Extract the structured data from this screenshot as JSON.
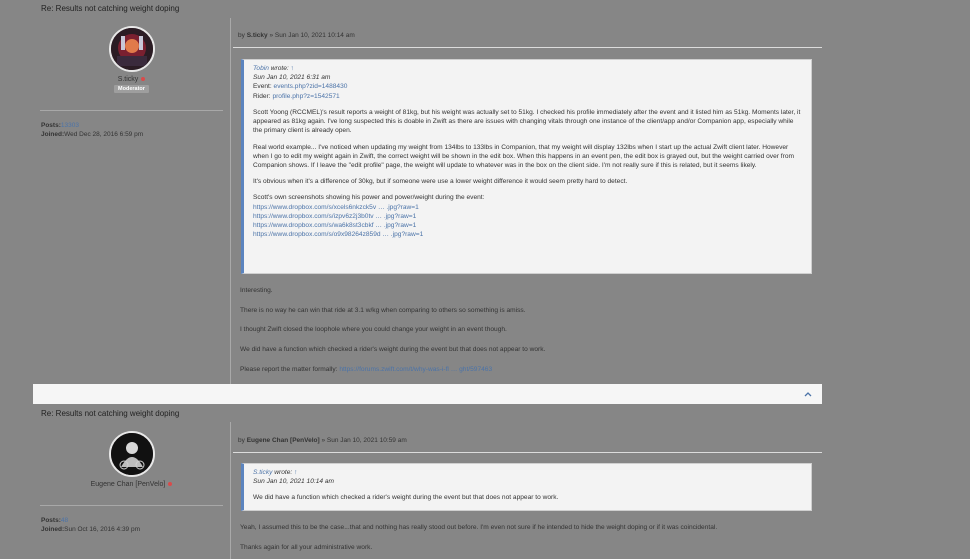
{
  "post1": {
    "title": "Re: Results not catching weight doping",
    "author": "S.ticky",
    "rank": "Moderator",
    "posts_label": "Posts:",
    "posts_value": "13303",
    "joined_label": "Joined:",
    "joined_value": "Wed Dec 28, 2016 6:59 pm",
    "by_prefix": "by",
    "by_author": "S.ticky",
    "by_date": "» Sun Jan 10, 2021 10:14 am",
    "quote": {
      "author": "Tobin",
      "wrote": "wrote:",
      "up": "↑",
      "date": "Sun Jan 10, 2021 6:31 am",
      "event_label": "Event:",
      "event_link": "events.php?zid=1488430",
      "rider_label": "Rider:",
      "rider_link": "profile.php?z=1542571",
      "para1": "Scott Yoong (RCCMEL)'s result reports a weight of 81kg, but his weight was actually set to 51kg. I checked his profile immediately after the event and it listed him as 51kg. Moments later, it appeared as 81kg again. I've long suspected this is doable in Zwift as there are issues with changing vitals through one instance of the client/app and/or Companion app, especially while the primary client is already open.",
      "para2": "Real world example... I've noticed when updating my weight from 134lbs to 133lbs in Companion, that my weight will display 132lbs when I start up the actual Zwift client later. However when I go to edit my weight again in Zwift, the correct weight will be shown in the edit box. When this happens in an event pen, the edit box is grayed out, but the weight carried over from Companion shows. If I leave the \"edit profile\" page, the weight will update to whatever was in the box on the client side. I'm not really sure if this is related, but it seems likely.",
      "para3": "It's obvious when it's a difference of 30kg, but if someone were use a lower weight difference it would seem pretty hard to detect.",
      "para4": "Scott's own screenshots showing his power and power/weight during the event:",
      "links": [
        "https://www.dropbox.com/s/xcels6nkzck5v … .jpg?raw=1",
        "https://www.dropbox.com/s/izpv6z2j3b0tv … .jpg?raw=1",
        "https://www.dropbox.com/s/wa6k8st3cbkf … .jpg?raw=1",
        "https://www.dropbox.com/s/o9x98264z859d … .jpg?raw=1"
      ]
    },
    "body": [
      "Interesting.",
      "There is no way he can win that ride at 3.1 w/kg when comparing to others so something is amiss.",
      "I thought Zwift closed the loophole where you could change your weight in an event though.",
      "We did have a function which checked a rider's weight during the event but that does not appear to work."
    ],
    "report_text": "Please report the matter formally: ",
    "report_link": "https://forums.zwift.com/t/why-was-i-fl … ght/597463"
  },
  "post2": {
    "title": "Re: Results not catching weight doping",
    "author": "Eugene Chan [PenVelo]",
    "posts_label": "Posts:",
    "posts_value": "48",
    "joined_label": "Joined:",
    "joined_value": "Sun Oct 16, 2016 4:39 pm",
    "by_prefix": "by",
    "by_author": "Eugene Chan [PenVelo]",
    "by_date": "» Sun Jan 10, 2021 10:59 am",
    "quote": {
      "author": "S.ticky",
      "wrote": "wrote:",
      "up": "↑",
      "date": "Sun Jan 10, 2021 10:14 am",
      "para1": "We did have a function which checked a rider's weight during the event but that does not appear to work."
    },
    "body": [
      "Yeah, I assumed this to be the case...that and nothing has really stood out before. I'm even not sure if he intended to hide the weight doping or if it was coincidental.",
      "Thanks again for all your administrative work."
    ]
  },
  "icons": {
    "back_to_top": "chevron-up-icon",
    "online": "online-status-icon"
  },
  "colors": {
    "background": "#868686",
    "link": "#4b73a8",
    "quote_border": "#5b84bf",
    "online": "#d94b4b"
  }
}
